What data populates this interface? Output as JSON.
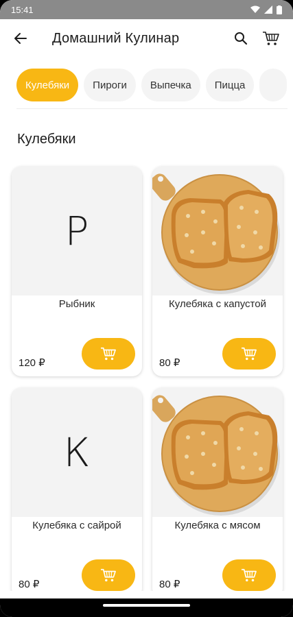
{
  "status": {
    "time": "15:41"
  },
  "appbar": {
    "title": "Домашний Кулинар"
  },
  "chips": [
    "Кулебяки",
    "Пироги",
    "Выпечка",
    "Пицца",
    ""
  ],
  "section": {
    "title": "Кулебяки"
  },
  "products": [
    {
      "name": "Рыбник",
      "price": "120 ₽",
      "image": "letter",
      "letter": "Р"
    },
    {
      "name": "Кулебяка с капустой",
      "price": "80 ₽",
      "image": "photo-pie"
    },
    {
      "name": "Кулебяка с сайрой",
      "price": "80 ₽",
      "image": "letter",
      "letter": "К"
    },
    {
      "name": "Кулебяка с мясом",
      "price": "80 ₽",
      "image": "photo-pie"
    }
  ],
  "colors": {
    "accent": "#f8b714",
    "placeholder_bg": "#f3f3f3",
    "chip_bg": "#f4f4f4"
  }
}
